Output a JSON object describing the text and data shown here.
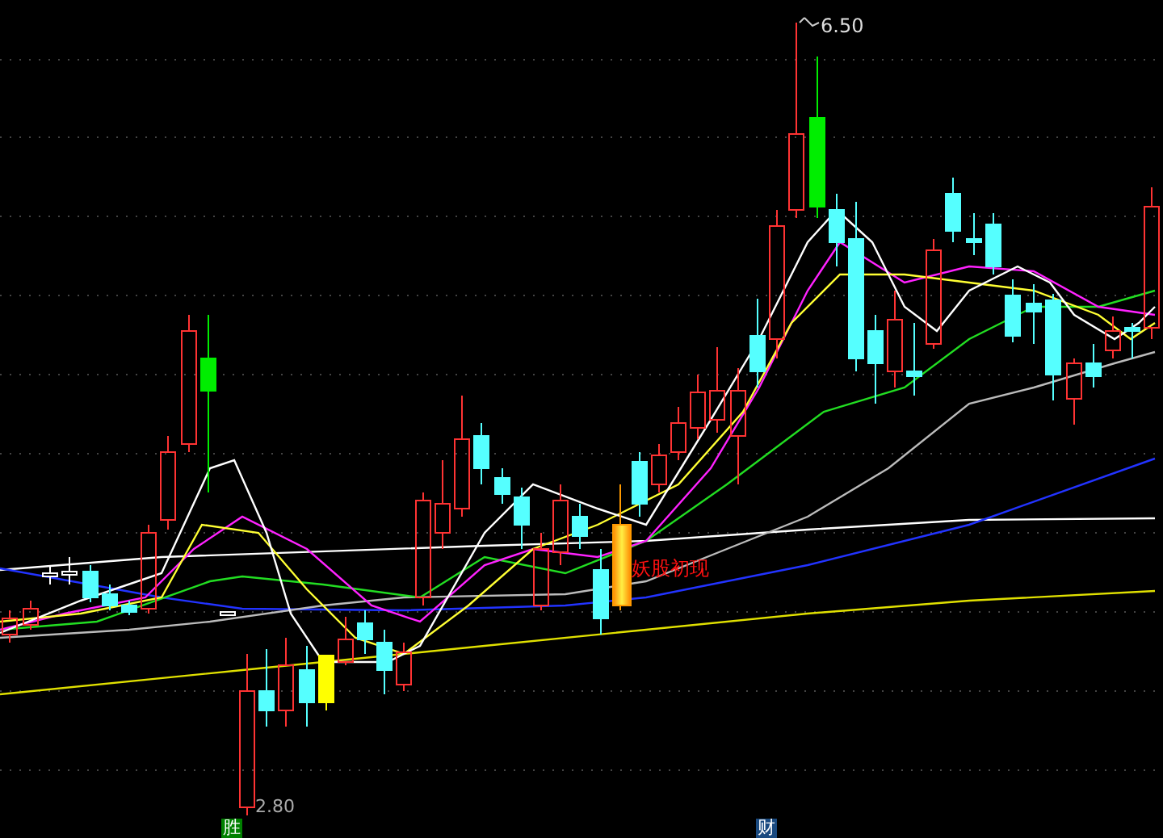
{
  "chart": {
    "high_label": "6.50",
    "low_label": "2.80",
    "signal_label": "妖股初现"
  },
  "markers": [
    {
      "label": "胜",
      "color": "#008000"
    },
    {
      "label": "财",
      "color": "#1a4a80"
    }
  ]
}
